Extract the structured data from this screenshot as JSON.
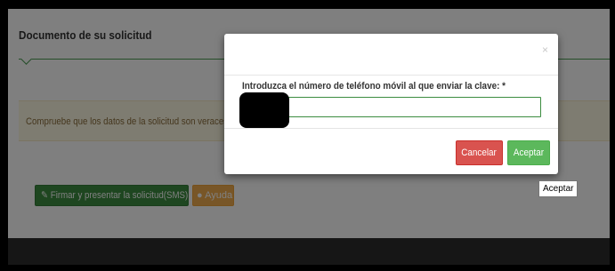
{
  "page": {
    "title": "Documento de su solicitud",
    "alert_text": "Compruebe que los datos de la solicitud son veraces y",
    "sign_button_icon": "edit-icon",
    "sign_button_label": "Firmar y presentar la solicitud(SMS)",
    "help_button_icon": "info-icon",
    "help_button_label": "Ayuda"
  },
  "modal": {
    "close_label": "×",
    "label": "Introduzca el número de teléfono móvil al que enviar la clave: *",
    "phone_value": "",
    "cancel_label": "Cancelar",
    "accept_label": "Aceptar"
  },
  "tooltip": {
    "text": "Aceptar"
  },
  "colors": {
    "accent_green": "#5cb85c",
    "danger_red": "#d9534f",
    "warning_orange": "#f0ad4e",
    "sign_green": "#3c8d40",
    "alert_bg": "#fcf8e3"
  }
}
